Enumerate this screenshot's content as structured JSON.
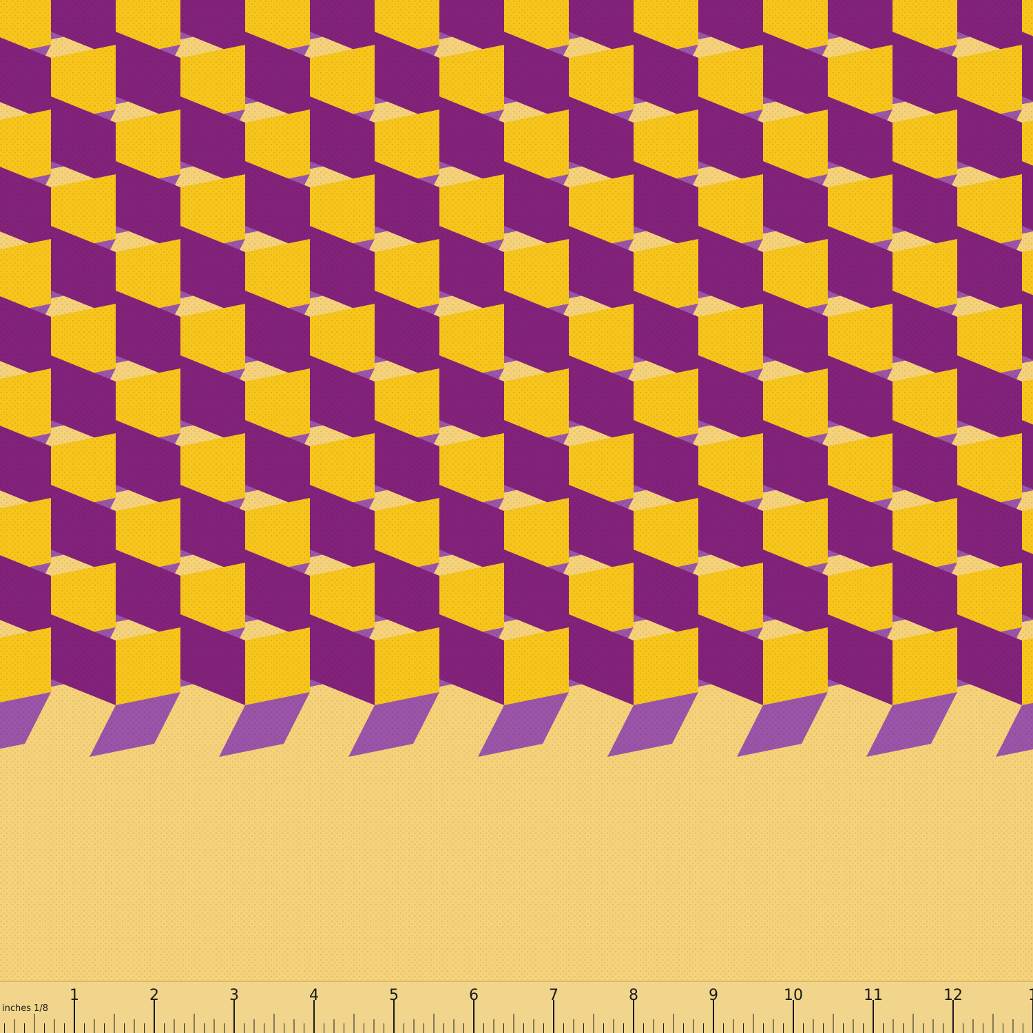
{
  "fabric": {
    "pattern": "isometric-cube-tiling",
    "colors": {
      "top_face": "#f6d27a",
      "left_face": "#f7c51b",
      "right_face": "#83227a",
      "side_face": "#9a55a8",
      "texture_dot": "#00000018"
    }
  },
  "ruler": {
    "unit_label": "inches 1/8",
    "numbers": [
      "1",
      "2",
      "3",
      "4",
      "5",
      "6",
      "7",
      "8",
      "9",
      "10",
      "11",
      "12",
      "1"
    ],
    "colors": {
      "body": "#f1d58c",
      "edge": "#d9b867",
      "ink": "#1a1a1a"
    }
  }
}
